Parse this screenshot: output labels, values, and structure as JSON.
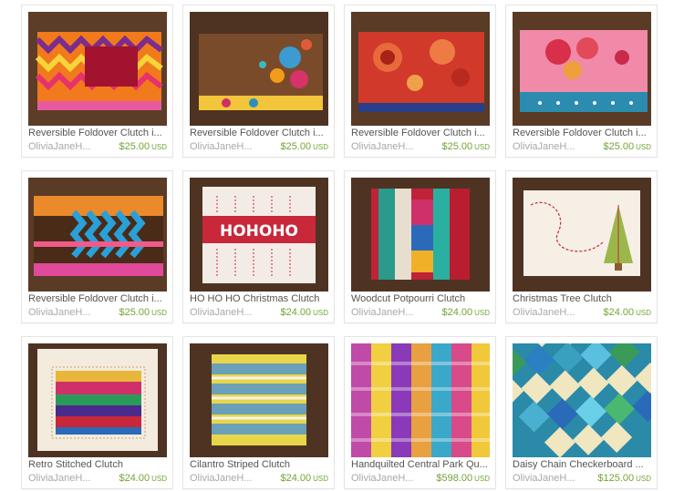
{
  "listings": [
    {
      "title": "Reversible Foldover Clutch i...",
      "shop": "OliviaJaneH...",
      "price": "$25.00",
      "currency": "USD",
      "image": "chevron-orange-clutch"
    },
    {
      "title": "Reversible Foldover Clutch i...",
      "shop": "OliviaJaneH...",
      "price": "$25.00",
      "currency": "USD",
      "image": "brown-floral-clutch"
    },
    {
      "title": "Reversible Foldover Clutch i...",
      "shop": "OliviaJaneH...",
      "price": "$25.00",
      "currency": "USD",
      "image": "red-floral-clutch"
    },
    {
      "title": "Reversible Foldover Clutch i...",
      "shop": "OliviaJaneH...",
      "price": "$25.00",
      "currency": "USD",
      "image": "pink-floral-clutch"
    },
    {
      "title": "Reversible Foldover Clutch i...",
      "shop": "OliviaJaneH...",
      "price": "$25.00",
      "currency": "USD",
      "image": "blue-chevron-clutch"
    },
    {
      "title": "HO HO HO Christmas Clutch",
      "shop": "OliviaJaneH...",
      "price": "$24.00",
      "currency": "USD",
      "image": "hohoho-clutch"
    },
    {
      "title": "Woodcut Potpourri Clutch",
      "shop": "OliviaJaneH...",
      "price": "$24.00",
      "currency": "USD",
      "image": "woodcut-patchwork-clutch"
    },
    {
      "title": "Christmas Tree Clutch",
      "shop": "OliviaJaneH...",
      "price": "$24.00",
      "currency": "USD",
      "image": "christmas-tree-clutch"
    },
    {
      "title": "Retro Stitched Clutch",
      "shop": "OliviaJaneH...",
      "price": "$24.00",
      "currency": "USD",
      "image": "retro-stitched-clutch"
    },
    {
      "title": "Cilantro Striped Clutch",
      "shop": "OliviaJaneH...",
      "price": "$24.00",
      "currency": "USD",
      "image": "cilantro-striped-clutch"
    },
    {
      "title": "Handquilted Central Park Qu...",
      "shop": "OliviaJaneH...",
      "price": "$598.00",
      "currency": "USD",
      "image": "central-park-quilt"
    },
    {
      "title": "Daisy Chain Checkerboard ...",
      "shop": "OliviaJaneH...",
      "price": "$125.00",
      "currency": "USD",
      "image": "daisy-chain-quilt"
    }
  ]
}
